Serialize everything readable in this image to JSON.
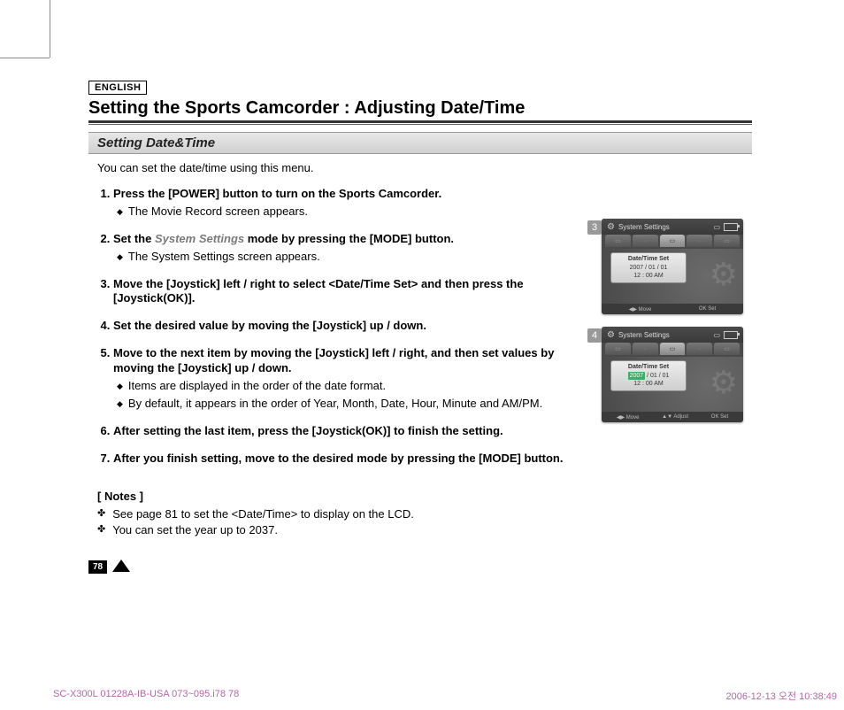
{
  "lang_label": "ENGLISH",
  "title": "Setting the Sports Camcorder : Adjusting Date/Time",
  "subhead": "Setting Date&Time",
  "intro": "You can set the date/time using this menu.",
  "steps": [
    {
      "text": "Press the [POWER] button to turn on the Sports Camcorder.",
      "subs": [
        "The Movie Record screen appears."
      ]
    },
    {
      "text_pre": "Set the ",
      "text_em": "System Settings",
      "text_post": " mode by pressing the [MODE] button.",
      "subs": [
        "The System Settings screen appears."
      ]
    },
    {
      "text": "Move the [Joystick] left / right to select <Date/Time Set> and then press the [Joystick(OK)].",
      "subs": []
    },
    {
      "text": "Set the desired value by moving the [Joystick] up / down.",
      "subs": []
    },
    {
      "text": "Move to the next item by moving the [Joystick] left / right, and then set values by moving the [Joystick] up / down.",
      "subs": [
        "Items are displayed in the order of the date format.",
        "By default, it appears in the order of Year, Month, Date, Hour, Minute and AM/PM."
      ]
    },
    {
      "text": "After setting the last item, press the [Joystick(OK)] to finish the setting.",
      "subs": []
    },
    {
      "text": "After you finish setting, move to the desired mode by pressing the [MODE] button.",
      "subs": []
    }
  ],
  "notes_heading": "[ Notes ]",
  "notes": [
    "See page 81 to set the <Date/Time> to display on the LCD.",
    "You can set the year up to 2037."
  ],
  "page_number": "78",
  "footer_left": "SC-X300L 01228A-IB-USA 073~095.i78   78",
  "footer_right": "2006-12-13   오전 10:38:49",
  "screens": {
    "s3": {
      "num": "3",
      "header": "System Settings",
      "panel_title": "Date/Time Set",
      "date": "2007 / 01 / 01",
      "time": "12 : 00  AM",
      "bottom_left": "Move",
      "bottom_right": "OK Set"
    },
    "s4": {
      "num": "4",
      "header": "System Settings",
      "panel_title": "Date/Time Set",
      "date_hl": "2007",
      "date_rest": " / 01 / 01",
      "time": "12 : 00  AM",
      "bottom_left": "Move",
      "bottom_mid": "Adjust",
      "bottom_right": "OK Set"
    }
  }
}
